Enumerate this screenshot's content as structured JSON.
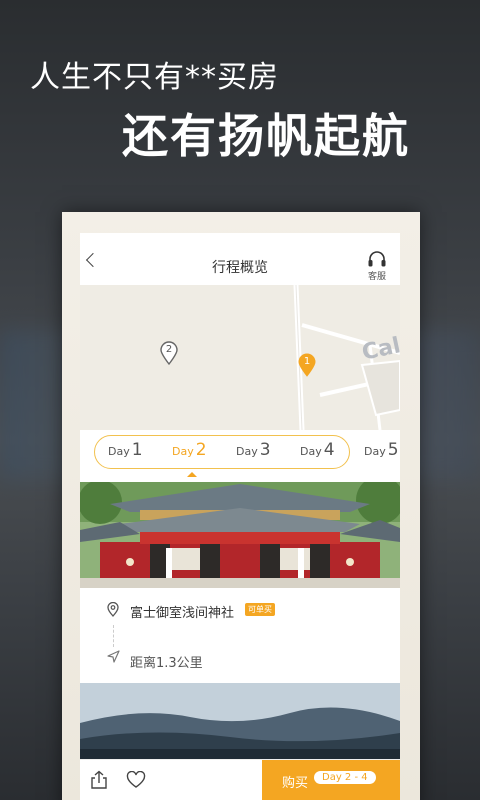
{
  "promo": {
    "line1": "人生不只有**买房",
    "line2": "还有扬帆起航"
  },
  "topbar": {
    "title": "行程概览",
    "service_label": "客服"
  },
  "map": {
    "pins": [
      "1",
      "2"
    ],
    "street_label": "Cal"
  },
  "days": [
    {
      "prefix": "Day",
      "num": "1",
      "active": false
    },
    {
      "prefix": "Day",
      "num": "2",
      "active": true
    },
    {
      "prefix": "Day",
      "num": "3",
      "active": false
    },
    {
      "prefix": "Day",
      "num": "4",
      "active": false
    },
    {
      "prefix": "Day",
      "num": "5",
      "active": false
    }
  ],
  "place": {
    "name": "富士御室浅间神社",
    "badge": "可单买",
    "distance": "距离1.3公里"
  },
  "bottom": {
    "buy_label": "购买",
    "buy_range": "Day 2 - 4"
  },
  "colors": {
    "accent": "#f4a622",
    "pill_border": "#f2c14e"
  },
  "icons": [
    "back-icon",
    "headset-icon",
    "location-pin-icon",
    "navigation-arrow-icon",
    "share-icon",
    "heart-icon"
  ]
}
